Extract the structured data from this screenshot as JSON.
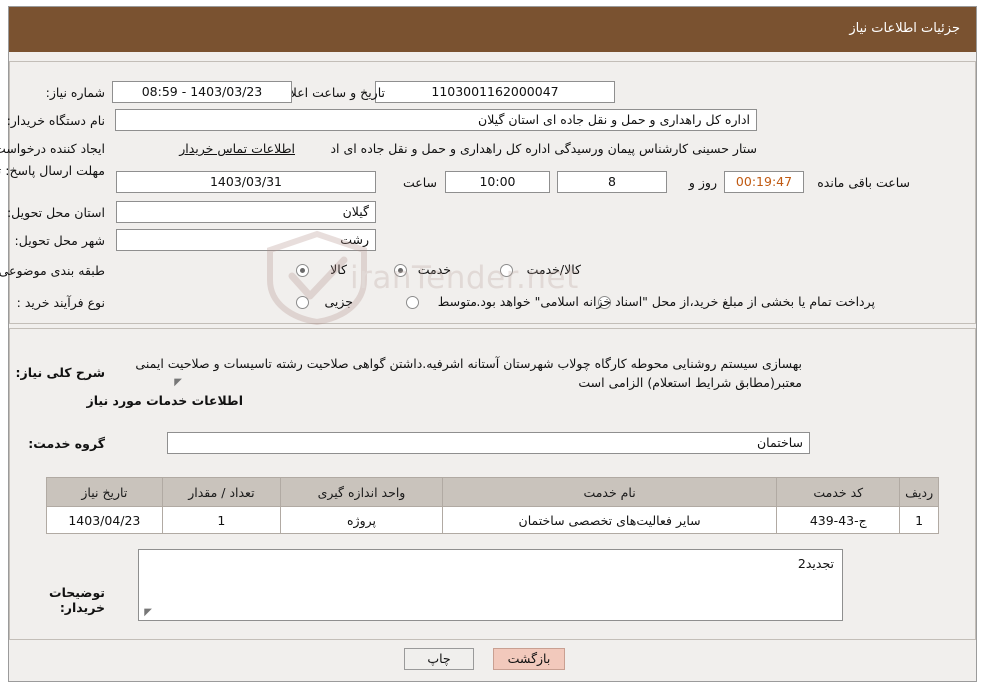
{
  "header": {
    "title": "جزئیات اطلاعات نیاز"
  },
  "top_form": {
    "need_number_label": "شماره نیاز:",
    "need_number_value": "1103001162000047",
    "announce_datetime_label": "تاریخ و ساعت اعلان عمومی:",
    "announce_datetime_value": "1403/03/23 - 08:59",
    "buyer_org_label": "نام دستگاه خریدار:",
    "buyer_org_value": "اداره کل راهداری و حمل و نقل جاده ای استان گیلان",
    "requester_label": "ایجاد کننده درخواست:",
    "requester_value": "ستار حسینی کارشناس پیمان ورسیدگی اداره کل راهداری و حمل و نقل جاده ای اد",
    "requester_link": "اطلاعات تماس خریدار",
    "deadline_label": "مهلت ارسال پاسخ: تا تاریخ:",
    "deadline_date": "1403/03/31",
    "deadline_hour_label": "ساعت",
    "deadline_hour": "10:00",
    "days_value": "8",
    "days_label": "روز و",
    "remaining_time": "00:19:47",
    "remaining_label": "ساعت باقی مانده",
    "province_label": "استان محل تحویل:",
    "province_value": "گیلان",
    "city_label": "شهر محل تحویل:",
    "city_value": "رشت",
    "category_label": "طبقه بندی موضوعی:",
    "category_options": [
      "کالا",
      "خدمت",
      "کالا/خدمت"
    ],
    "category_selected": "خدمت",
    "purchase_type_label": "نوع فرآیند خرید :",
    "purchase_type_options": [
      "جزیی",
      "متوسط"
    ],
    "purchase_type_selected": "",
    "purchase_note": "پرداخت تمام یا بخشی از مبلغ خرید،از محل \"اسناد خزانه اسلامی\" خواهد بود."
  },
  "middle": {
    "general_desc_label": "شرح کلی نیاز:",
    "general_desc_value": "بهسازی سیستم روشنایی محوطه کارگاه چولاب شهرستان آستانه اشرفیه.داشتن گواهی صلاحیت رشته تاسیسات و صلاحیت ایمنی معتبر(مطابق شرایط استعلام) الزامی است",
    "services_info_title": "اطلاعات خدمات مورد نیاز",
    "service_group_label": "گروه خدمت:",
    "service_group_value": "ساختمان",
    "table": {
      "columns": [
        "ردیف",
        "کد خدمت",
        "نام خدمت",
        "واحد اندازه گیری",
        "تعداد / مقدار",
        "تاریخ نیاز"
      ],
      "rows": [
        {
          "row": "1",
          "code": "ج-43-439",
          "name": "سایر فعالیت‌های تخصصی ساختمان",
          "unit": "پروژه",
          "qty": "1",
          "date": "1403/04/23"
        }
      ]
    },
    "buyer_notes_label": "توضیحات خریدار:",
    "buyer_notes_value": "تجدید2"
  },
  "footer": {
    "print_label": "چاپ",
    "back_label": "بازگشت"
  },
  "watermark": {
    "text": "iranTender.net",
    "icon": "shield-icon"
  },
  "colors": {
    "header_bg": "#7a5230",
    "page_bg": "#f1efed",
    "link": "#1f4fa8",
    "accent_orange": "#c05a12",
    "back_button": "#f2c9bc"
  }
}
